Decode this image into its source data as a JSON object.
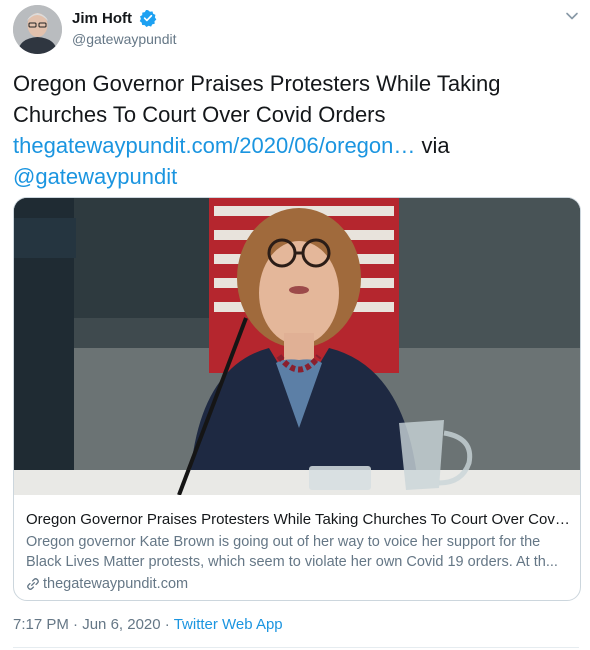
{
  "author": {
    "display_name": "Jim Hoft",
    "handle": "@gatewaypundit"
  },
  "tweet": {
    "text": "Oregon Governor Praises Protesters While Taking Churches To Court Over Covid Orders",
    "link_text": "thegatewaypundit.com/2020/06/oregon…",
    "via_text": "via",
    "mention": "@gatewaypundit"
  },
  "card": {
    "title": "Oregon Governor Praises Protesters While Taking Churches To Court Over Covid ...",
    "description": "Oregon governor Kate Brown is going out of her way to voice her support for the Black Lives Matter protests, which seem to violate her own Covid 19 orders. At th...",
    "domain": "thegatewaypundit.com"
  },
  "meta": {
    "time": "7:17 PM",
    "separator": "·",
    "date": "Jun 6, 2020",
    "source": "Twitter Web App"
  },
  "icons": {
    "verified": "verified-badge-icon",
    "caret": "chevron-down-icon",
    "link": "link-icon"
  },
  "colors": {
    "link": "#1b95e0",
    "secondary_text": "#657786",
    "border": "#ccd6dd"
  }
}
